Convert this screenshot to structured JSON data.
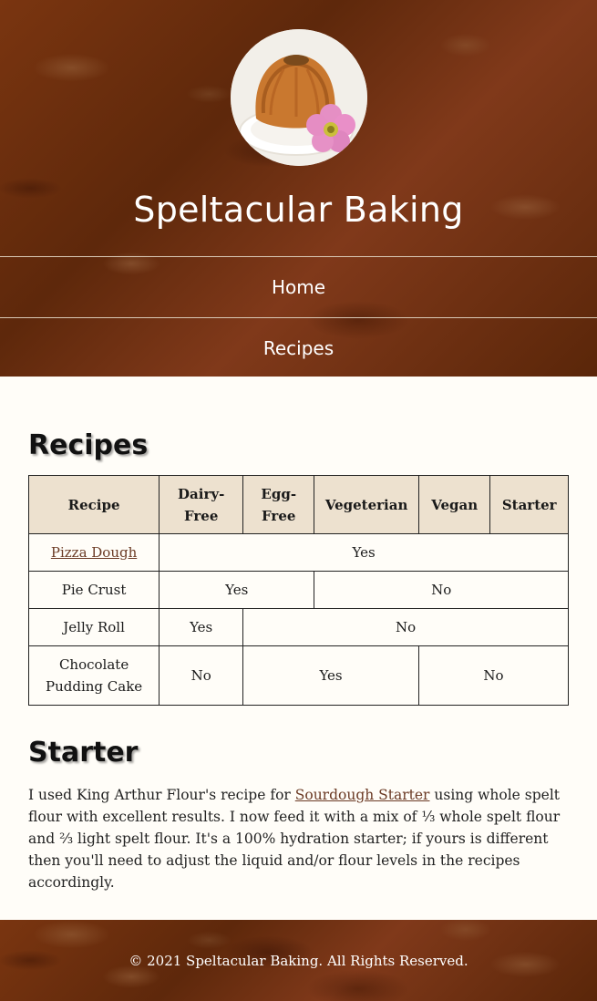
{
  "site": {
    "title": "Speltacular Baking"
  },
  "nav": {
    "items": [
      {
        "label": "Home"
      },
      {
        "label": "Recipes"
      }
    ]
  },
  "recipes_section": {
    "heading": "Recipes",
    "columns": [
      "Recipe",
      "Dairy-Free",
      "Egg-Free",
      "Vegeterian",
      "Vegan",
      "Starter"
    ],
    "rows": [
      {
        "recipe": "Pizza Dough",
        "cells": [
          "Yes"
        ]
      },
      {
        "recipe": "Pie Crust",
        "cells": [
          "Yes",
          "No"
        ]
      },
      {
        "recipe": "Jelly Roll",
        "cells": [
          "Yes",
          "No"
        ]
      },
      {
        "recipe": "Chocolate Pudding Cake",
        "cells": [
          "No",
          "Yes",
          "No"
        ]
      }
    ]
  },
  "starter_section": {
    "heading": "Starter",
    "text_before_link": "I used King Arthur Flour's recipe for ",
    "link_text": "Sourdough Starter",
    "text_after_link": " using whole spelt flour with excellent results. I now feed it with a mix of ⅓ whole spelt flour and ⅔ light spelt flour. It's a 100% hydration starter; if yours is different then you'll need to adjust the liquid and/or flour levels in the recipes accordingly."
  },
  "footer": {
    "text": "© 2021 Speltacular Baking. All Rights Reserved."
  },
  "colors": {
    "header_bg": "#6b2f0d",
    "table_header_bg": "#ede1cf",
    "link": "#6b3a24",
    "page_bg": "#fffdf8"
  },
  "icons": {
    "logo": "bundt-cake-with-flower-logo"
  }
}
